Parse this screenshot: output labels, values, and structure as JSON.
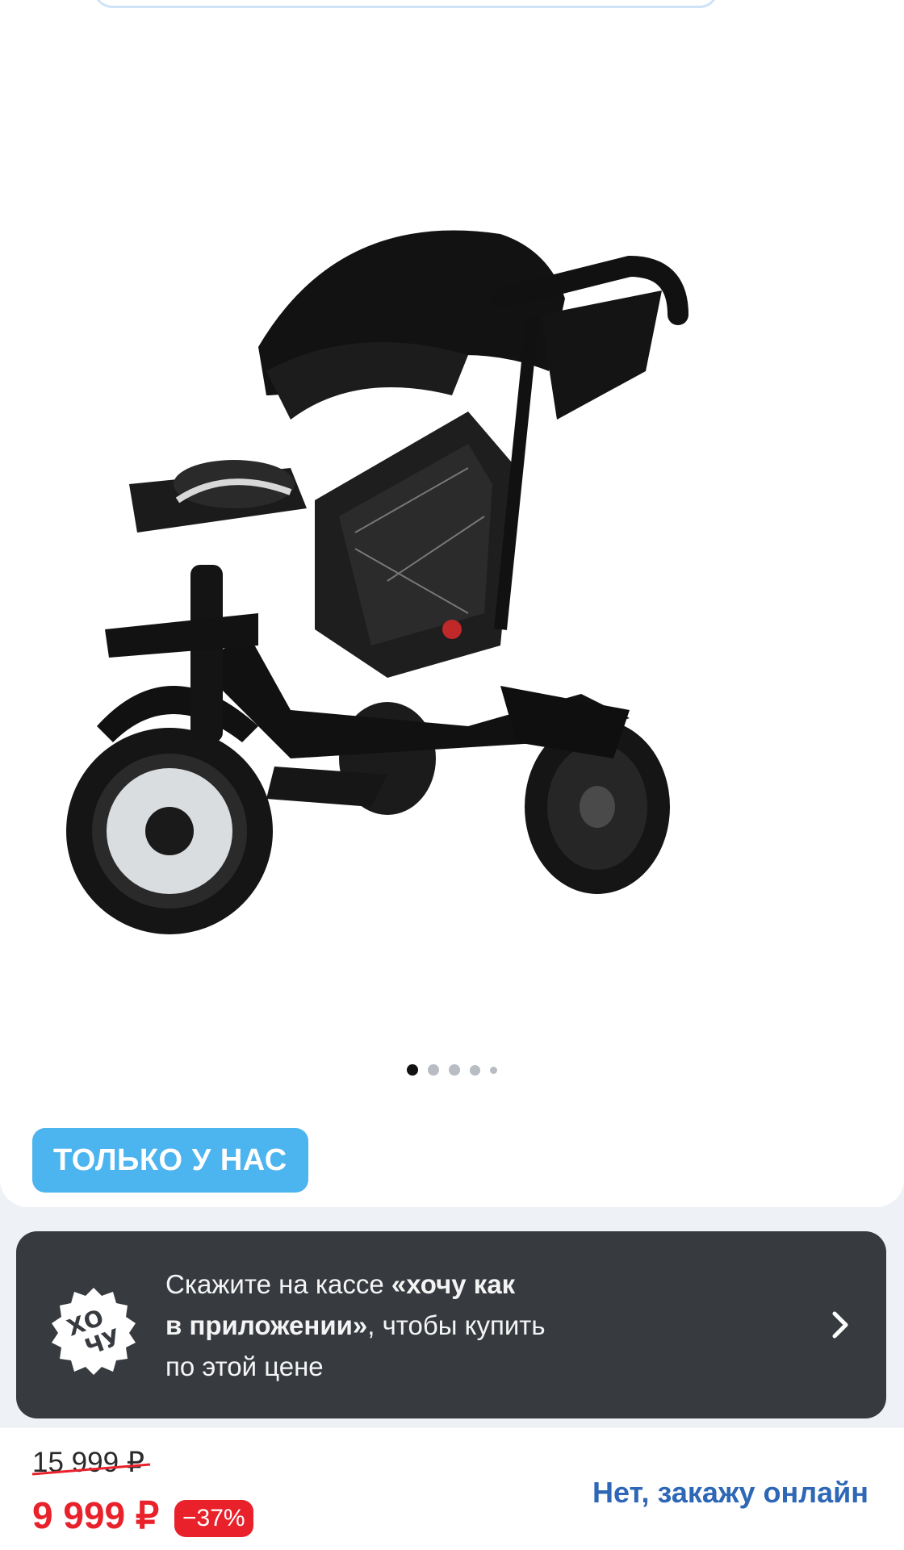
{
  "gallery": {
    "image_alt": "product-photo",
    "dots_total": 5,
    "active_index": 0
  },
  "badge": {
    "label": "ТОЛЬКО У НАС"
  },
  "promo": {
    "logo_text_top": "ХО",
    "logo_text_bottom": "ЧУ",
    "line1_regular": "Скажите на кассе ",
    "line1_bold": "«хочу как",
    "line2_bold": "в приложении»",
    "line2_regular": ", чтобы купить",
    "line3": "по этой цене",
    "icon": "chevron-right-icon"
  },
  "pricing": {
    "old_price": "15 999 ₽",
    "new_price": "9 999 ₽",
    "discount": "−37%",
    "order_online": "Нет, закажу онлайн"
  },
  "colors": {
    "accent_blue": "#4cb4ee",
    "price_red": "#e8212b",
    "link_blue": "#2d67b6",
    "promo_bg": "#373a3f"
  }
}
